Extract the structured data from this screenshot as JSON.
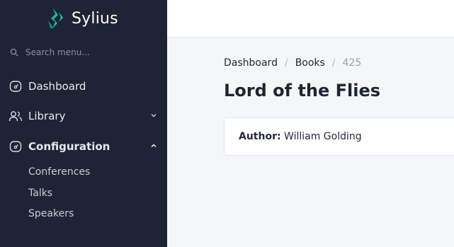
{
  "brand": {
    "name": "Sylius",
    "accent": "#1abb9c"
  },
  "search": {
    "placeholder": "Search menu..."
  },
  "sidebar": {
    "items": [
      {
        "label": "Dashboard",
        "icon": "dashboard-icon"
      },
      {
        "label": "Library",
        "icon": "users-icon",
        "expanded": false
      },
      {
        "label": "Configuration",
        "icon": "dashboard-icon",
        "expanded": true,
        "children": [
          {
            "label": "Conferences"
          },
          {
            "label": "Talks"
          },
          {
            "label": "Speakers"
          }
        ]
      }
    ]
  },
  "breadcrumb": {
    "items": [
      {
        "label": "Dashboard"
      },
      {
        "label": "Books"
      }
    ],
    "current": "425",
    "separator": "/"
  },
  "page": {
    "title": "Lord of the Flies"
  },
  "details": {
    "author_key": "Author:",
    "author_value": "William Golding"
  },
  "colors": {
    "sidebar_bg": "#1e2436",
    "page_bg": "#f5f6f8"
  }
}
